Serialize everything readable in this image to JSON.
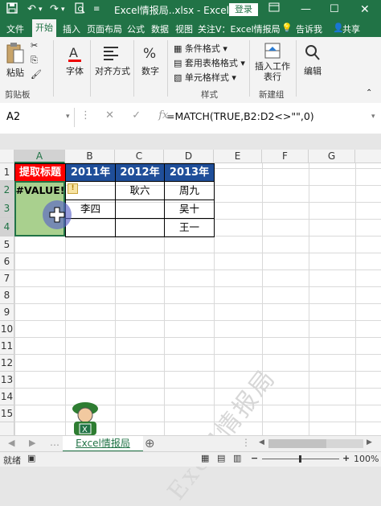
{
  "titlebar": {
    "title": "Excel情报局..xlsx - Excel(...",
    "login_label": "登录"
  },
  "menu": {
    "tabs": [
      "文件",
      "开始",
      "插入",
      "页面布局",
      "公式",
      "数据",
      "视图",
      "关注V：Excel情报局",
      "告诉我",
      "共享"
    ]
  },
  "ribbon": {
    "paste": "粘贴",
    "font": "字体",
    "align": "对齐方式",
    "number": "数字",
    "cond_format": "条件格式",
    "table_format": "套用表格格式",
    "cell_style": "单元格样式",
    "insert_row": "插入工作表行",
    "edit": "编辑",
    "groups": {
      "clipboard": "剪贴板",
      "styles": "样式",
      "new_group": "新建组"
    }
  },
  "formula_bar": {
    "name_box": "A2",
    "fx": "fx",
    "formula": "=MATCH(TRUE,B2:D2<>\"\",0)"
  },
  "sheet": {
    "columns": [
      "A",
      "B",
      "C",
      "D",
      "E",
      "F",
      "G"
    ],
    "rows": [
      "1",
      "2",
      "3",
      "4",
      "5",
      "6",
      "7",
      "8",
      "9",
      "10",
      "11",
      "12",
      "13",
      "14",
      "15"
    ],
    "header_row": {
      "a1": "提取标题",
      "b1": "2011年",
      "c1": "2012年",
      "d1": "2013年"
    },
    "cells": {
      "a2": "#VALUE!",
      "c2": "耿六",
      "d2": "周九",
      "b3": "李四",
      "d3": "吴十",
      "d4": "王一"
    },
    "error_indicator": "!",
    "watermark": "Excel情报局"
  },
  "tab_bar": {
    "sheet_tab": "Excel情报局",
    "add_sheet": "⊕"
  },
  "status_bar": {
    "status": "就绪",
    "zoom": "100%"
  },
  "colors": {
    "excel_green": "#217346",
    "header_red": "#ff0000",
    "header_blue": "#1f4e99",
    "selection_green": "#a9d08e"
  }
}
